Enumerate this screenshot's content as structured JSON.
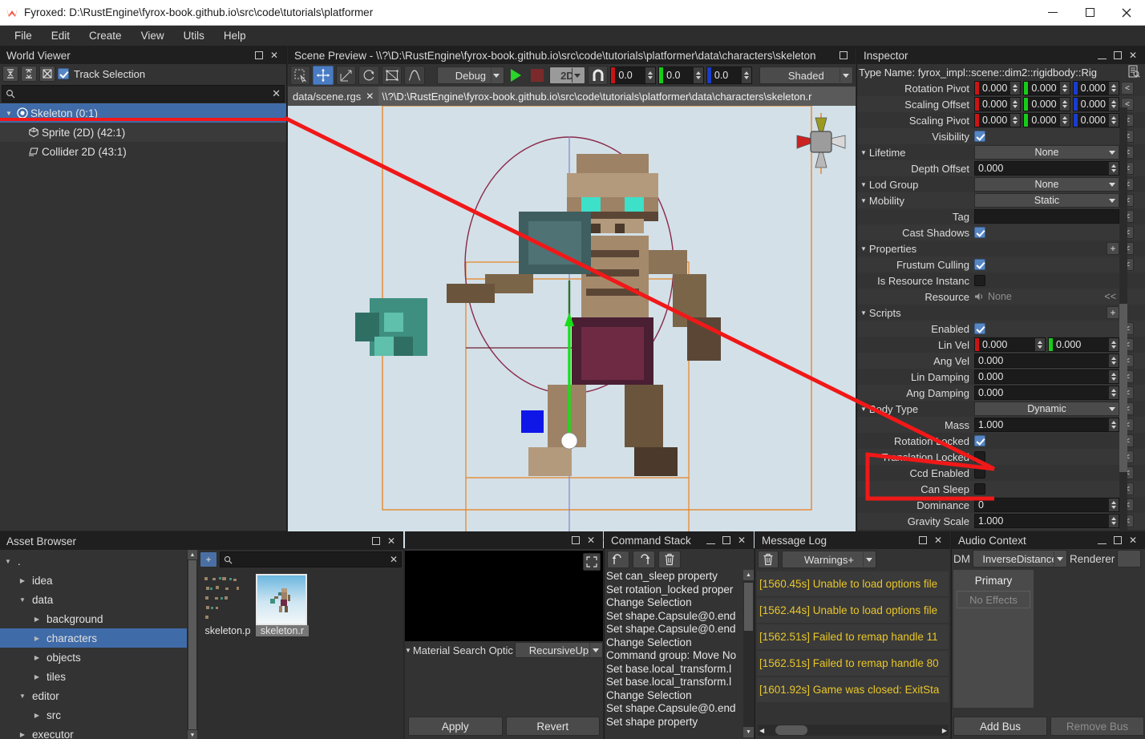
{
  "window": {
    "title": "Fyroxed: D:\\RustEngine\\fyrox-book.github.io\\src\\code\\tutorials\\platformer",
    "minimize": "—",
    "maximize": "▢",
    "close": "✕"
  },
  "menu": {
    "items": [
      "File",
      "Edit",
      "Create",
      "View",
      "Utils",
      "Help"
    ]
  },
  "world_viewer": {
    "title": "World Viewer",
    "toolbar": {
      "collapse_all": "collapse-all",
      "expand_all": "expand-all",
      "locate": "locate-selection",
      "track_selection_label": "Track Selection",
      "track_selection_checked": true
    },
    "search_placeholder": "",
    "search_value": "",
    "tree": [
      {
        "label": "Skeleton (0:1)",
        "icon": "pivot-icon",
        "selected": true,
        "expanded": true,
        "depth": 0
      },
      {
        "label": "Sprite (2D) (42:1)",
        "icon": "cube-icon",
        "selected": false,
        "expanded": false,
        "depth": 1
      },
      {
        "label": "Collider 2D (43:1)",
        "icon": "collider-icon",
        "selected": false,
        "expanded": false,
        "depth": 1
      }
    ]
  },
  "scene": {
    "title": "Scene Preview - \\\\?\\D:\\RustEngine\\fyrox-book.github.io\\src\\code\\tutorials\\platformer\\data\\characters\\skeleton",
    "tools": [
      {
        "name": "select-tool",
        "active": false
      },
      {
        "name": "move-tool",
        "active": true
      },
      {
        "name": "scale-tool",
        "active": false
      },
      {
        "name": "rotate-tool",
        "active": false
      },
      {
        "name": "navmesh-tool",
        "active": false
      },
      {
        "name": "terrain-tool",
        "active": false
      }
    ],
    "build_profile": "Debug",
    "play_label": "play",
    "stop_label": "stop",
    "mode_2d": "2D",
    "snapping": "magnet",
    "snap_x": "0.0",
    "snap_y": "0.0",
    "snap_z": "0.0",
    "render_mode": "Shaded",
    "tabs": [
      {
        "label": "data/scene.rgs",
        "closable": true,
        "active": false
      },
      {
        "label": "\\\\?\\D:\\RustEngine\\fyrox-book.github.io\\src\\code\\tutorials\\platformer\\data\\characters\\skeleton.r",
        "closable": false,
        "active": true
      }
    ]
  },
  "inspector": {
    "title": "Inspector",
    "type_name": "Type Name: fyrox_impl::scene::dim2::rigidbody::Rig",
    "rows": [
      {
        "label": "Rotation Pivot",
        "kind": "vec3",
        "values": [
          "0.000",
          "0.000",
          "0.000"
        ],
        "indent": 1,
        "revert": true,
        "expander": ""
      },
      {
        "label": "Scaling Offset",
        "kind": "vec3",
        "values": [
          "0.000",
          "0.000",
          "0.000"
        ],
        "indent": 1,
        "revert": true,
        "expander": ""
      },
      {
        "label": "Scaling Pivot",
        "kind": "vec3",
        "values": [
          "0.000",
          "0.000",
          "0.000"
        ],
        "indent": 1,
        "revert": true,
        "expander": ""
      },
      {
        "label": "Visibility",
        "kind": "check",
        "checked": true,
        "indent": 1,
        "revert": true,
        "expander": ""
      },
      {
        "label": "Lifetime",
        "kind": "dropdown",
        "value": "None",
        "indent": 0,
        "revert": true,
        "expander": "▼"
      },
      {
        "label": "Depth Offset",
        "kind": "number",
        "value": "0.000",
        "indent": 1,
        "revert": true,
        "expander": ""
      },
      {
        "label": "Lod Group",
        "kind": "dropdown",
        "value": "None",
        "indent": 0,
        "revert": true,
        "expander": "▼"
      },
      {
        "label": "Mobility",
        "kind": "dropdown",
        "value": "Static",
        "indent": 0,
        "revert": true,
        "expander": "▼"
      },
      {
        "label": "Tag",
        "kind": "text",
        "value": "",
        "indent": 1,
        "revert": true,
        "expander": ""
      },
      {
        "label": "Cast Shadows",
        "kind": "check",
        "checked": true,
        "indent": 1,
        "revert": true,
        "expander": ""
      },
      {
        "label": "Properties",
        "kind": "plus",
        "indent": 0,
        "revert": true,
        "expander": "▼"
      },
      {
        "label": "Frustum Culling",
        "kind": "check",
        "checked": true,
        "indent": 1,
        "revert": true,
        "expander": ""
      },
      {
        "label": "Is Resource Instanc",
        "kind": "check",
        "checked": false,
        "indent": 1,
        "revert": false,
        "expander": ""
      },
      {
        "label": "Resource",
        "kind": "resource",
        "value": "None",
        "indent": 1,
        "revert": false,
        "expander": "",
        "revert_label": "<<"
      },
      {
        "label": "Scripts",
        "kind": "plusonly",
        "indent": 0,
        "revert": false,
        "expander": "▼"
      },
      {
        "label": "Enabled",
        "kind": "check",
        "checked": true,
        "indent": 1,
        "revert": true,
        "expander": ""
      },
      {
        "label": "Lin Vel",
        "kind": "vec2",
        "values": [
          "0.000",
          "0.000"
        ],
        "indent": 1,
        "revert": true,
        "expander": ""
      },
      {
        "label": "Ang Vel",
        "kind": "number",
        "value": "0.000",
        "indent": 1,
        "revert": true,
        "expander": ""
      },
      {
        "label": "Lin Damping",
        "kind": "number",
        "value": "0.000",
        "indent": 1,
        "revert": true,
        "expander": ""
      },
      {
        "label": "Ang Damping",
        "kind": "number",
        "value": "0.000",
        "indent": 1,
        "revert": true,
        "expander": ""
      },
      {
        "label": "Body Type",
        "kind": "dropdown",
        "value": "Dynamic",
        "indent": 0,
        "revert": true,
        "expander": "▼"
      },
      {
        "label": "Mass",
        "kind": "number",
        "value": "1.000",
        "indent": 1,
        "revert": true,
        "expander": ""
      },
      {
        "label": "Rotation Locked",
        "kind": "check",
        "checked": true,
        "indent": 1,
        "revert": true,
        "expander": ""
      },
      {
        "label": "Translation Locked",
        "kind": "check",
        "checked": false,
        "indent": 1,
        "revert": true,
        "expander": ""
      },
      {
        "label": "Ccd Enabled",
        "kind": "check",
        "checked": false,
        "indent": 1,
        "revert": true,
        "expander": ""
      },
      {
        "label": "Can Sleep",
        "kind": "check",
        "checked": false,
        "indent": 1,
        "revert": true,
        "expander": ""
      },
      {
        "label": "Dominance",
        "kind": "number",
        "value": "0",
        "indent": 1,
        "revert": true,
        "expander": ""
      },
      {
        "label": "Gravity Scale",
        "kind": "number",
        "value": "1.000",
        "indent": 1,
        "revert": true,
        "expander": ""
      }
    ]
  },
  "asset_browser": {
    "title": "Asset Browser",
    "search_value": "",
    "add_label": "+",
    "tree": [
      {
        "label": ".",
        "depth": 0,
        "expanded": true,
        "selected": false
      },
      {
        "label": "idea",
        "depth": 1,
        "expanded": false,
        "selected": false
      },
      {
        "label": "data",
        "depth": 1,
        "expanded": true,
        "selected": false
      },
      {
        "label": "background",
        "depth": 2,
        "expanded": false,
        "selected": false
      },
      {
        "label": "characters",
        "depth": 2,
        "expanded": false,
        "selected": true
      },
      {
        "label": "objects",
        "depth": 2,
        "expanded": false,
        "selected": false
      },
      {
        "label": "tiles",
        "depth": 2,
        "expanded": false,
        "selected": false
      },
      {
        "label": "editor",
        "depth": 1,
        "expanded": true,
        "selected": false
      },
      {
        "label": "src",
        "depth": 2,
        "expanded": false,
        "selected": false
      },
      {
        "label": "executor",
        "depth": 1,
        "expanded": false,
        "selected": false
      }
    ],
    "items": [
      {
        "label": "skeleton.p",
        "selected": false,
        "kind": "sprite-sheet"
      },
      {
        "label": "skeleton.r",
        "selected": true,
        "kind": "prefab"
      }
    ]
  },
  "material": {
    "search_option_label": "Material Search Optic",
    "search_option_value": "RecursiveUp",
    "apply_label": "Apply",
    "revert_label": "Revert"
  },
  "command_stack": {
    "title": "Command Stack",
    "toolbar": [
      "undo-icon",
      "redo-icon",
      "clear-icon"
    ],
    "items": [
      "Set can_sleep property",
      "Set rotation_locked proper",
      "Change Selection",
      "Set shape.Capsule@0.end",
      "Set shape.Capsule@0.end",
      "Change Selection",
      "Command group: Move No",
      "Set base.local_transform.l",
      "Set base.local_transform.l",
      "Change Selection",
      "Set shape.Capsule@0.end",
      "Set shape property"
    ]
  },
  "message_log": {
    "title": "Message Log",
    "clear_label": "clear-icon",
    "filter_value": "Warnings+",
    "entries": [
      "[1560.45s] Unable to load options file",
      "[1562.44s] Unable to load options file",
      "[1562.51s] Failed to remap handle 11",
      "[1562.51s] Failed to remap handle 80",
      "[1601.92s] Game was closed: ExitSta"
    ]
  },
  "audio_context": {
    "title": "Audio Context",
    "dm_label": "DM",
    "distance_model": "InverseDistance",
    "renderer_label": "Renderer",
    "renderer_value": "",
    "bus_name": "Primary",
    "no_effects": "No Effects",
    "add_bus": "Add Bus",
    "remove_bus": "Remove Bus"
  },
  "colors": {
    "accent_blue": "#3f6ba8",
    "annotation_red": "#f01818",
    "warning_yellow": "#e8c62a",
    "axis_x": "#cc1414",
    "axis_y": "#17cc17",
    "axis_z": "#1a3ccc",
    "viewport_bg": "#d3e0e8",
    "gizmo_orange": "#e8821e"
  }
}
